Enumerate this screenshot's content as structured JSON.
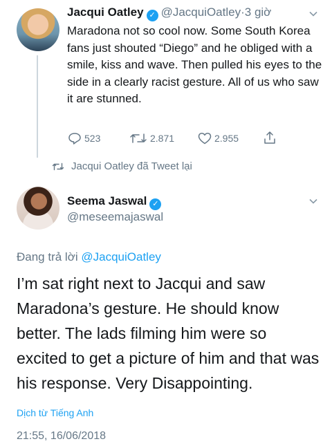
{
  "tweet1": {
    "author_name": "Jacqui Oatley",
    "handle": "@JacquiOatley",
    "separator": "·",
    "time": "3 giờ",
    "text": "Maradona not so cool now. Some South Korea fans just shouted “Diego” and he obliged with a smile, kiss and wave. Then pulled his eyes to the side in a clearly racist gesture. All of us who saw it are stunned.",
    "replies": "523",
    "retweets": "2.871",
    "likes": "2.955"
  },
  "retweet_notice": {
    "text": "Jacqui Oatley đã Tweet lại"
  },
  "tweet2": {
    "author_name": "Seema Jaswal",
    "handle": "@meseemajaswal",
    "replying_prefix": "Đang trả lời",
    "replying_to": "@JacquiOatley",
    "text": "I’m sat right next to Jacqui and saw Maradona’s gesture.  He should know better. The lads filming him were so excited to get a picture of him and that was his response. Very Disappointing.",
    "translate_label": "Dịch từ Tiếng Anh",
    "timestamp": "21:55, 16/06/2018"
  },
  "colors": {
    "accent": "#1da1f2",
    "secondary_text": "#657786",
    "primary_text": "#14171a"
  },
  "icons": {
    "verified": "verified-badge-icon",
    "chevron": "chevron-down-icon",
    "reply": "reply-icon",
    "retweet": "retweet-icon",
    "like": "heart-icon",
    "share": "share-icon"
  }
}
